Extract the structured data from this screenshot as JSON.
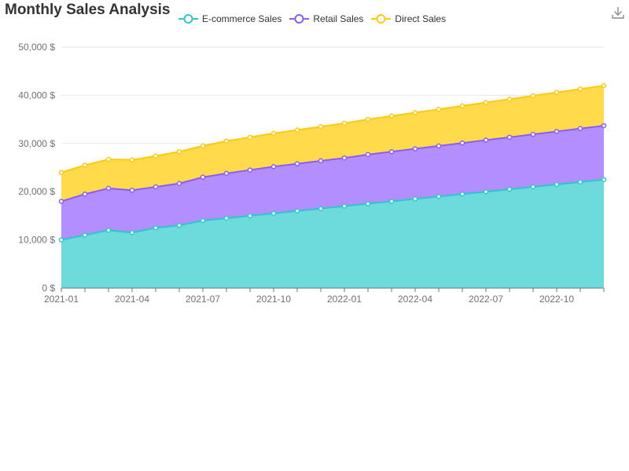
{
  "title": "Monthly Sales Analysis",
  "legend": [
    {
      "label": "E-commerce Sales",
      "color": "#2EC7C9"
    },
    {
      "label": "Retail Sales",
      "color": "#8B5CF6"
    },
    {
      "label": "Direct Sales",
      "color": "#FFC90E"
    }
  ],
  "toolbar": {
    "download_icon": "download-icon"
  },
  "chart_data": {
    "type": "area",
    "stacked": true,
    "title": "Monthly Sales Analysis",
    "x": [
      "2021-01",
      "2021-02",
      "2021-03",
      "2021-04",
      "2021-05",
      "2021-06",
      "2021-07",
      "2021-08",
      "2021-09",
      "2021-10",
      "2021-11",
      "2021-12",
      "2022-01",
      "2022-02",
      "2022-03",
      "2022-04",
      "2022-05",
      "2022-06",
      "2022-07",
      "2022-08",
      "2022-09",
      "2022-10",
      "2022-11",
      "2022-12"
    ],
    "x_ticks": [
      "2021-01",
      "2021-04",
      "2021-07",
      "2021-10",
      "2022-01",
      "2022-04",
      "2022-07",
      "2022-10"
    ],
    "y_ticks": [
      "0 $",
      "10,000 $",
      "20,000 $",
      "30,000 $",
      "40,000 $",
      "50,000 $"
    ],
    "ylim": [
      0,
      50000
    ],
    "grid": true,
    "legend_position": "top-center",
    "series": [
      {
        "name": "E-commerce Sales",
        "color": "#2EC7C9",
        "values": [
          10000,
          11000,
          12000,
          11500,
          12500,
          13000,
          14000,
          14500,
          15000,
          15500,
          16000,
          16500,
          17000,
          17500,
          18000,
          18500,
          19000,
          19500,
          20000,
          20500,
          21000,
          21500,
          22000,
          22500
        ]
      },
      {
        "name": "Retail Sales",
        "color": "#8B5CF6",
        "values": [
          8000,
          8500,
          8700,
          8800,
          8500,
          8700,
          9000,
          9300,
          9500,
          9700,
          9800,
          9900,
          10000,
          10200,
          10300,
          10400,
          10500,
          10600,
          10700,
          10800,
          10900,
          11000,
          11100,
          11200
        ]
      },
      {
        "name": "Direct Sales",
        "color": "#FFC90E",
        "values": [
          6000,
          6000,
          6000,
          6300,
          6400,
          6600,
          6500,
          6700,
          6800,
          6900,
          7000,
          7100,
          7200,
          7300,
          7400,
          7500,
          7600,
          7700,
          7800,
          7900,
          8000,
          8100,
          8200,
          8300
        ]
      }
    ]
  }
}
